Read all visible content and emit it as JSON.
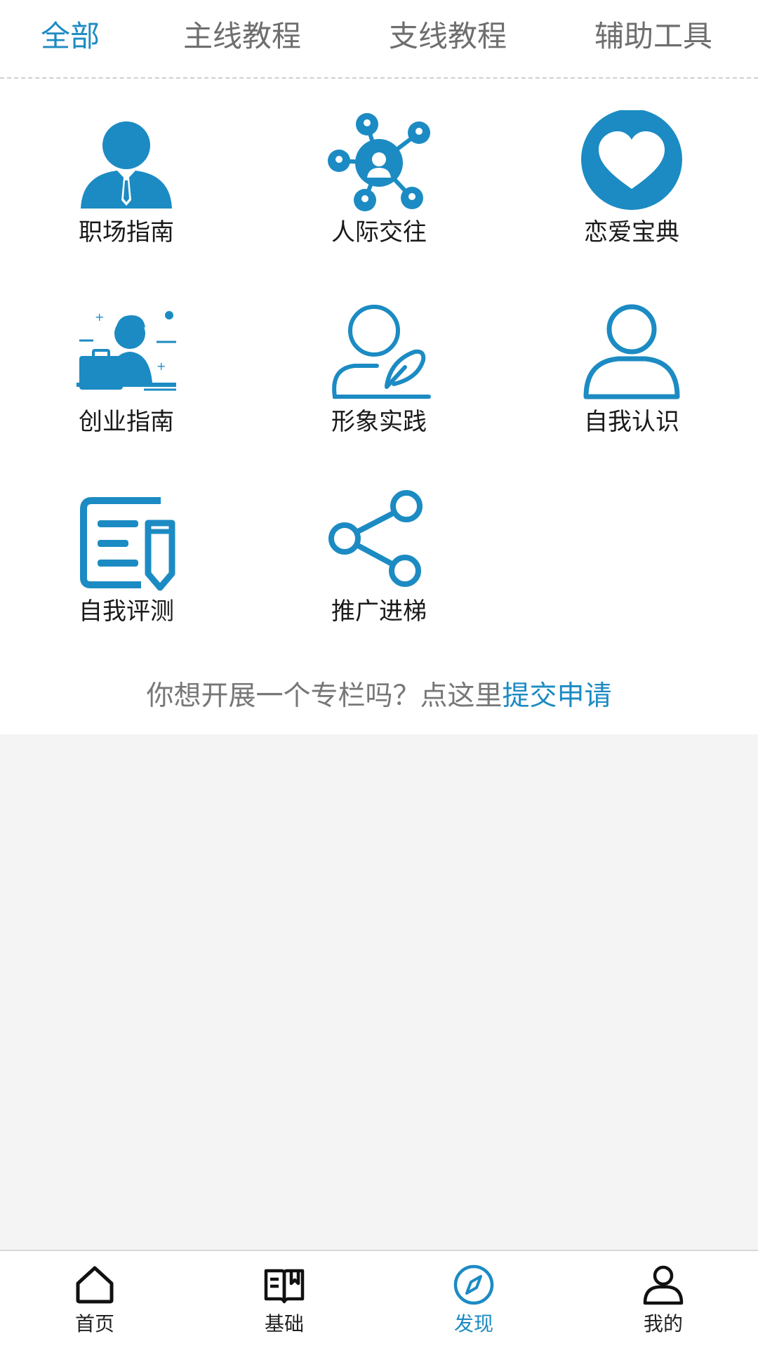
{
  "colors": {
    "accent": "#1c8bc3",
    "tab_inactive": "#6e6e6e",
    "icon_blue": "#1c8bc3",
    "page_bg": "#f4f4f4"
  },
  "tabs": [
    {
      "label": "全部",
      "active": true
    },
    {
      "label": "主线教程",
      "active": false
    },
    {
      "label": "支线教程",
      "active": false
    },
    {
      "label": "辅助工具",
      "active": false
    }
  ],
  "grid": [
    {
      "label": "职场指南",
      "icon": "businessman-icon"
    },
    {
      "label": "人际交往",
      "icon": "network-icon"
    },
    {
      "label": "恋爱宝典",
      "icon": "heart-icon"
    },
    {
      "label": "创业指南",
      "icon": "entrepreneur-icon"
    },
    {
      "label": "形象实践",
      "icon": "user-quill-icon"
    },
    {
      "label": "自我认识",
      "icon": "user-outline-icon"
    },
    {
      "label": "自我评测",
      "icon": "document-pencil-icon"
    },
    {
      "label": "推广进梯",
      "icon": "share-icon"
    }
  ],
  "apply": {
    "prompt": "你想开展一个专栏吗？点这里",
    "link": "提交申请"
  },
  "bottom_nav": [
    {
      "label": "首页",
      "icon": "home-icon",
      "active": false
    },
    {
      "label": "基础",
      "icon": "book-icon",
      "active": false
    },
    {
      "label": "发现",
      "icon": "compass-icon",
      "active": true
    },
    {
      "label": "我的",
      "icon": "person-icon",
      "active": false
    }
  ]
}
